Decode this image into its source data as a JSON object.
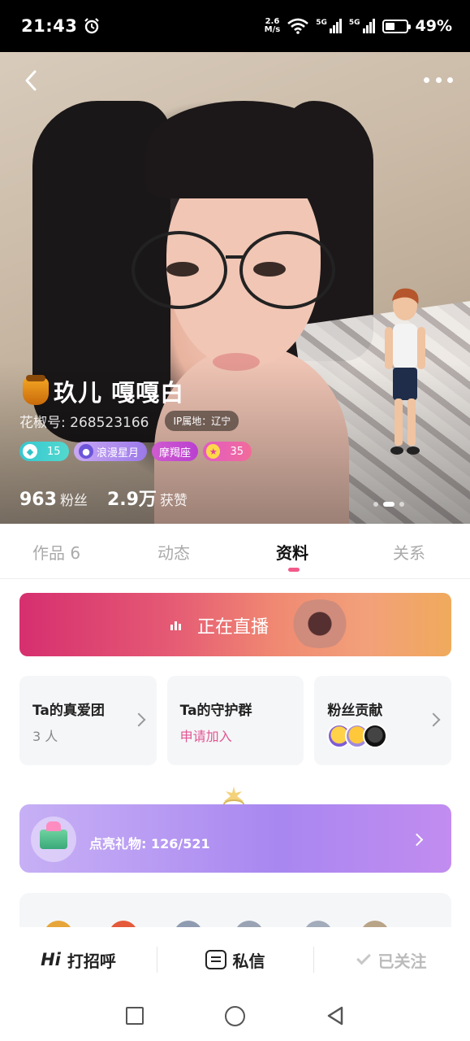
{
  "status_bar": {
    "time": "21:43",
    "net_speed_value": "2.6",
    "net_speed_unit": "M/s",
    "sim1": "5G",
    "sim2": "5G",
    "battery": "49%",
    "battery_level": 0.49
  },
  "profile": {
    "name": "玖儿 嘎嘎白",
    "id_label": "花椒号: 268523166",
    "ip_location": "IP属地：辽宁",
    "badges": {
      "diamond_level": "15",
      "planet_title": "浪漫星月",
      "zodiac": "摩羯座",
      "star_level": "35"
    },
    "fans_count": "963",
    "fans_label": "粉丝",
    "likes_count": "2.9万",
    "likes_label": "获赞"
  },
  "tabs": {
    "works": "作品 6",
    "moments": "动态",
    "info": "资料",
    "relations": "关系",
    "active": "资料"
  },
  "live": {
    "label": "正在直播"
  },
  "cards": {
    "love_group_title": "Ta的真爱团",
    "love_group_count": "3 人",
    "guard_group_title": "Ta的守护群",
    "guard_group_action": "申请加入",
    "fan_contrib_title": "粉丝贡献"
  },
  "gifts": {
    "label": "点亮礼物: 126/521"
  },
  "actions": {
    "hi_prefix": "Hi",
    "greet": "打招呼",
    "message": "私信",
    "followed": "已关注"
  },
  "colors": {
    "accent_pink": "#e25593",
    "tab_indicator": "#f25a8a",
    "diamond_badge": "#36c7d0",
    "gift_banner": "#b99cf3"
  }
}
